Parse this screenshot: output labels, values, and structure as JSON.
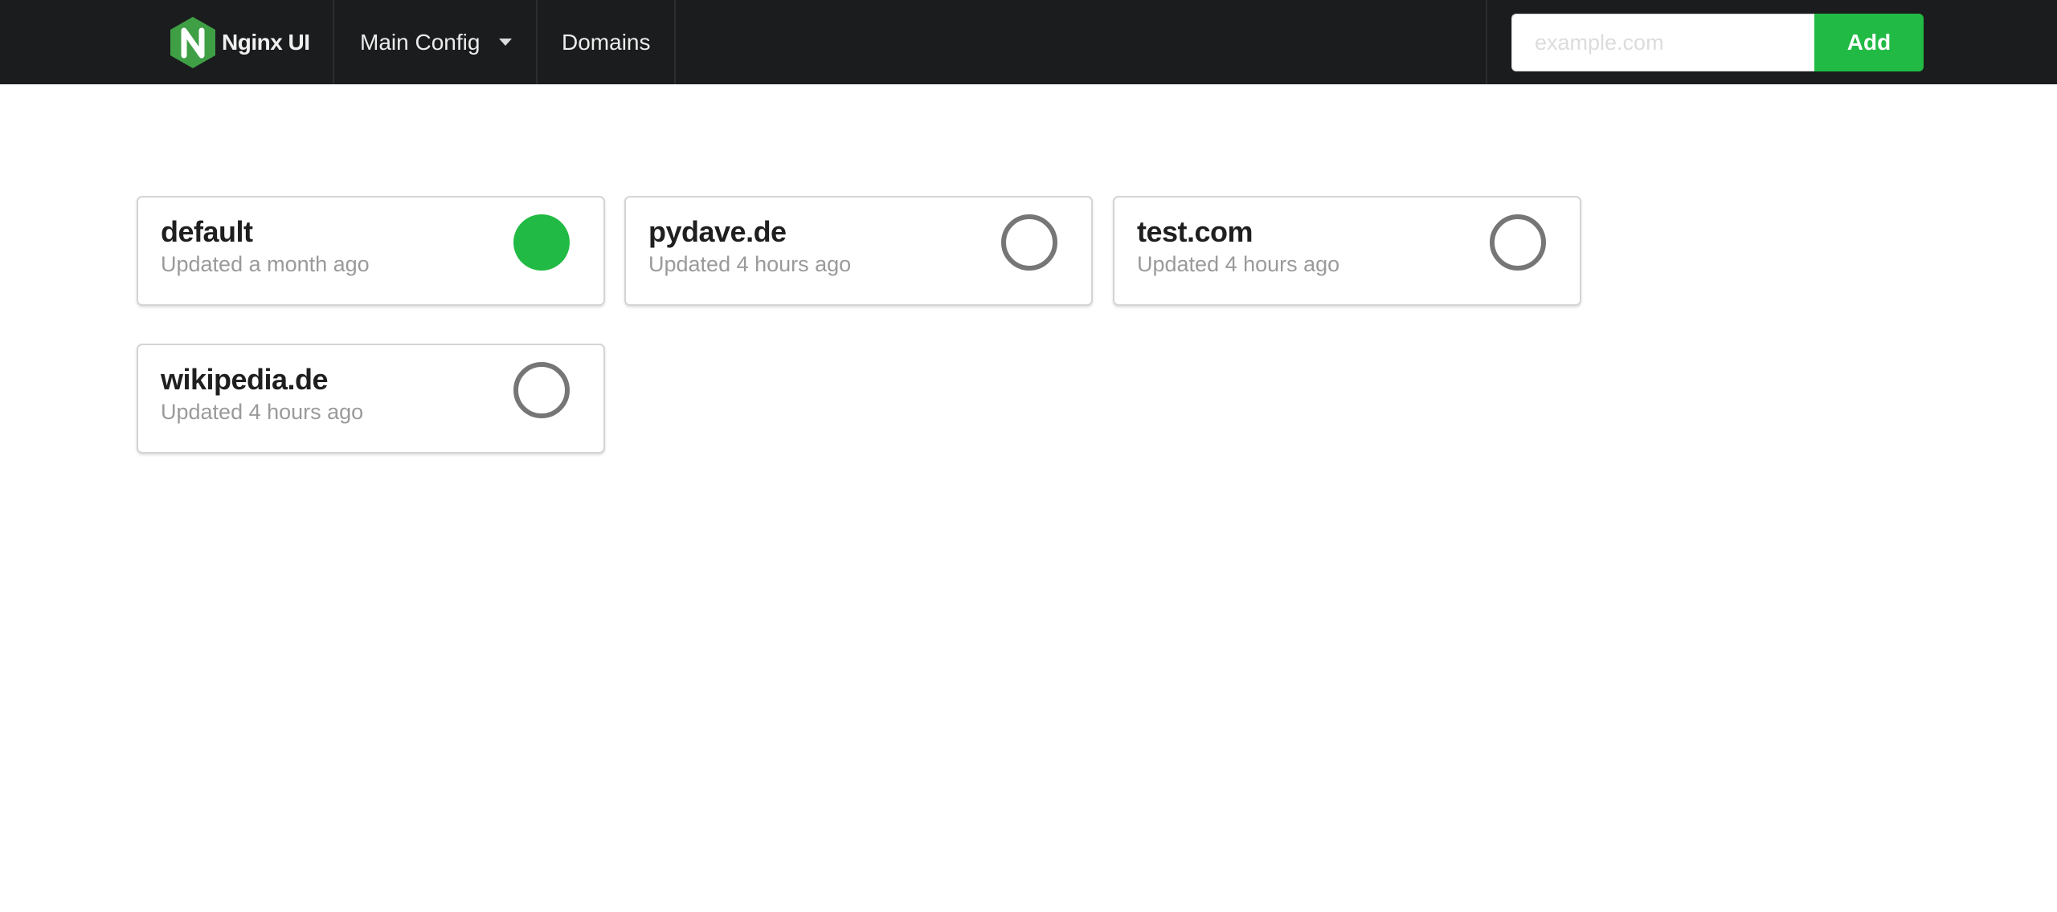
{
  "navbar": {
    "brand": "Nginx UI",
    "logo_letter": "N",
    "items": [
      {
        "label": "Main Config",
        "has_dropdown": true
      },
      {
        "label": "Domains"
      }
    ],
    "domain_input": {
      "value": "",
      "placeholder": "example.com"
    },
    "add_button": "Add"
  },
  "colors": {
    "navbar_bg": "#1b1c1d",
    "accent_green": "#21ba45",
    "logo_green": "#3f9f45",
    "inactive_status": "#767676"
  },
  "domains": [
    {
      "name": "default",
      "updated": "Updated a month ago",
      "enabled": true
    },
    {
      "name": "pydave.de",
      "updated": "Updated 4 hours ago",
      "enabled": false
    },
    {
      "name": "test.com",
      "updated": "Updated 4 hours ago",
      "enabled": false
    },
    {
      "name": "wikipedia.de",
      "updated": "Updated 4 hours ago",
      "enabled": false
    }
  ]
}
